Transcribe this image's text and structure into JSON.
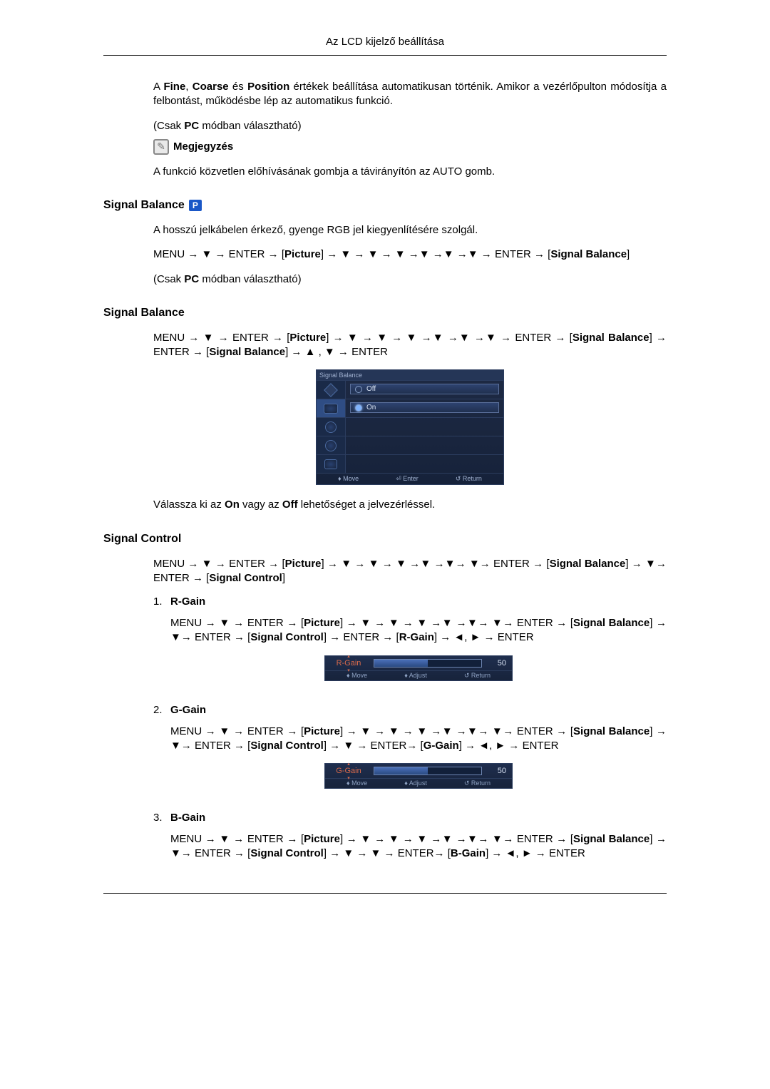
{
  "header": {
    "title": "Az LCD kijelző beállítása"
  },
  "intro": {
    "p1": "A Fine, Coarse és Position értékek beállítása automatikusan történik. Amikor a vezérlőpulton módosítja a felbontást, működésbe lép az automatikus funkció.",
    "p2": "(Csak PC módban választható)",
    "note_label": "Megjegyzés",
    "p3": "A funkció közvetlen előhívásának gombja a távirányítón az AUTO gomb."
  },
  "sec1": {
    "title": "Signal Balance",
    "badge": "P",
    "p1": "A hosszú jelkábelen érkező, gyenge RGB jel kiegyenlítésére szolgál.",
    "p2": "MENU → ▼ → ENTER → [Picture] → ▼ → ▼ → ▼ →▼ →▼ →▼ → ENTER → [Signal Balance]",
    "p3": "(Csak PC módban választható)"
  },
  "sec2": {
    "title": "Signal Balance",
    "p1": "MENU → ▼ → ENTER → [Picture] → ▼ → ▼ → ▼ →▼ →▼ →▼ → ENTER → [Signal Balance] → ENTER → [Signal Balance] → ▲ , ▼ → ENTER",
    "osd": {
      "header": "Signal Balance",
      "opt_off": "Off",
      "opt_on": "On",
      "footer": {
        "move": "♦ Move",
        "enter": "⏎ Enter",
        "ret": "↺ Return"
      }
    },
    "p2": "Válassza ki az On vagy az Off lehetőséget a jelvezérléssel."
  },
  "sec3": {
    "title": "Signal Control",
    "p1": "MENU → ▼ → ENTER → [Picture] → ▼ → ▼ → ▼ →▼ →▼→ ▼→ ENTER → [Signal Balance] → ▼→ ENTER → [Signal Control]",
    "items": [
      {
        "num": "1.",
        "label": "R-Gain",
        "p": "MENU → ▼ → ENTER → [Picture] → ▼ → ▼ → ▼ →▼ →▼→ ▼→ ENTER → [Signal Balance] → ▼→ ENTER → [Signal Control] → ENTER → [R-Gain] → ◄, ► → ENTER",
        "slider": {
          "label": "R-Gain",
          "value": "50",
          "fill_pct": 50,
          "footer": {
            "move": "♦ Move",
            "adjust": "♦ Adjust",
            "ret": "↺ Return"
          }
        }
      },
      {
        "num": "2.",
        "label": "G-Gain",
        "p": "MENU → ▼ → ENTER → [Picture] → ▼ → ▼ → ▼ →▼ →▼→ ▼→ ENTER → [Signal Balance] → ▼→ ENTER → [Signal Control] → ▼ → ENTER→ [G-Gain] → ◄, ► → ENTER",
        "slider": {
          "label": "G-Gain",
          "value": "50",
          "fill_pct": 50,
          "footer": {
            "move": "♦ Move",
            "adjust": "♦ Adjust",
            "ret": "↺ Return"
          }
        }
      },
      {
        "num": "3.",
        "label": "B-Gain",
        "p": "MENU → ▼ → ENTER → [Picture] → ▼ → ▼ → ▼ →▼ →▼→ ▼→ ENTER → [Signal Balance] → ▼→ ENTER → [Signal Control] → ▼ → ▼ → ENTER→ [B-Gain] → ◄, ► → ENTER"
      }
    ]
  }
}
